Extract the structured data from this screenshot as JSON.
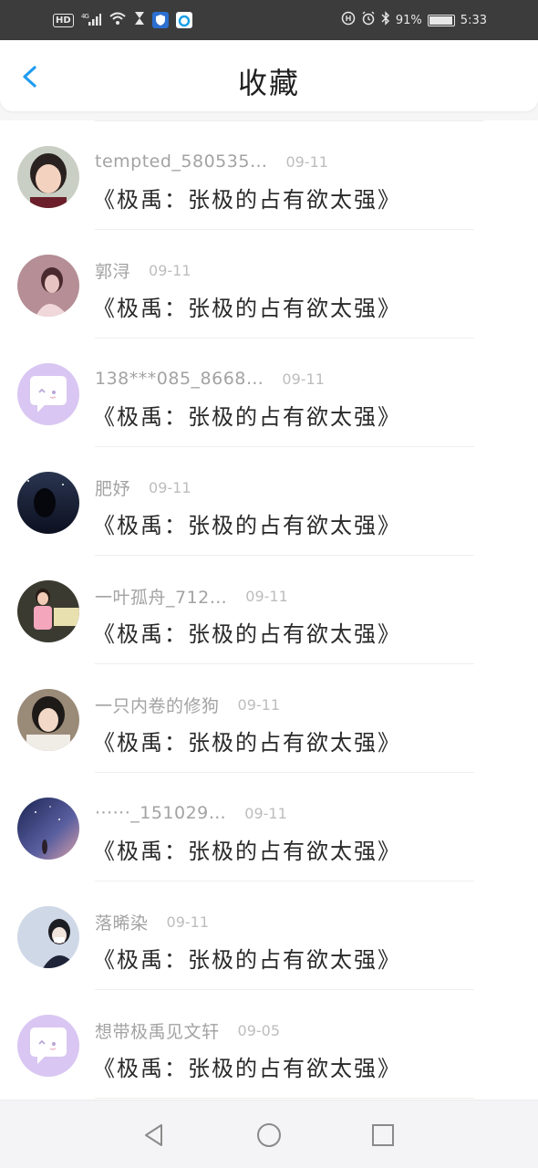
{
  "status_bar": {
    "network_badge": "HD",
    "signal_text": "⁴ᴳ",
    "battery_percent": "91%",
    "time": "5:33"
  },
  "header": {
    "title": "收藏"
  },
  "items": [
    {
      "username": "tempted_580535…",
      "date": "09-11",
      "content": "《极禹：张极的占有欲太强》",
      "avatar": "photo-girl-smiling"
    },
    {
      "username": "郭浔",
      "date": "09-11",
      "content": "《极禹：张极的占有欲太强》",
      "avatar": "photo-pink-girl"
    },
    {
      "username": "138***085_8668…",
      "date": "09-11",
      "content": "《极禹：张极的占有欲太强》",
      "avatar": "default-chat-bubble"
    },
    {
      "username": "肥妤",
      "date": "09-11",
      "content": "《极禹：张极的占有欲太强》",
      "avatar": "photo-night-sky"
    },
    {
      "username": "一叶孤舟_712…",
      "date": "09-11",
      "content": "《极禹：张极的占有欲太强》",
      "avatar": "photo-girl-pink-outfit"
    },
    {
      "username": "一只内卷的修狗",
      "date": "09-11",
      "content": "《极禹：张极的占有欲太强》",
      "avatar": "photo-girl-hand-face"
    },
    {
      "username": "······_151029…",
      "date": "09-11",
      "content": "《极禹：张极的占有欲太强》",
      "avatar": "photo-starry-sky"
    },
    {
      "username": "落晞染",
      "date": "09-11",
      "content": "《极禹：张极的占有欲太强》",
      "avatar": "photo-girl-mask"
    },
    {
      "username": "想带极禹见文轩",
      "date": "09-05",
      "content": "《极禹：张极的占有欲太强》",
      "avatar": "default-chat-bubble"
    }
  ],
  "nav": {
    "back": "nav-back-icon",
    "home": "nav-home-icon",
    "recents": "nav-recents-icon"
  },
  "colors": {
    "accent": "#1e9cf0",
    "default_avatar": "#d9c6f2"
  }
}
